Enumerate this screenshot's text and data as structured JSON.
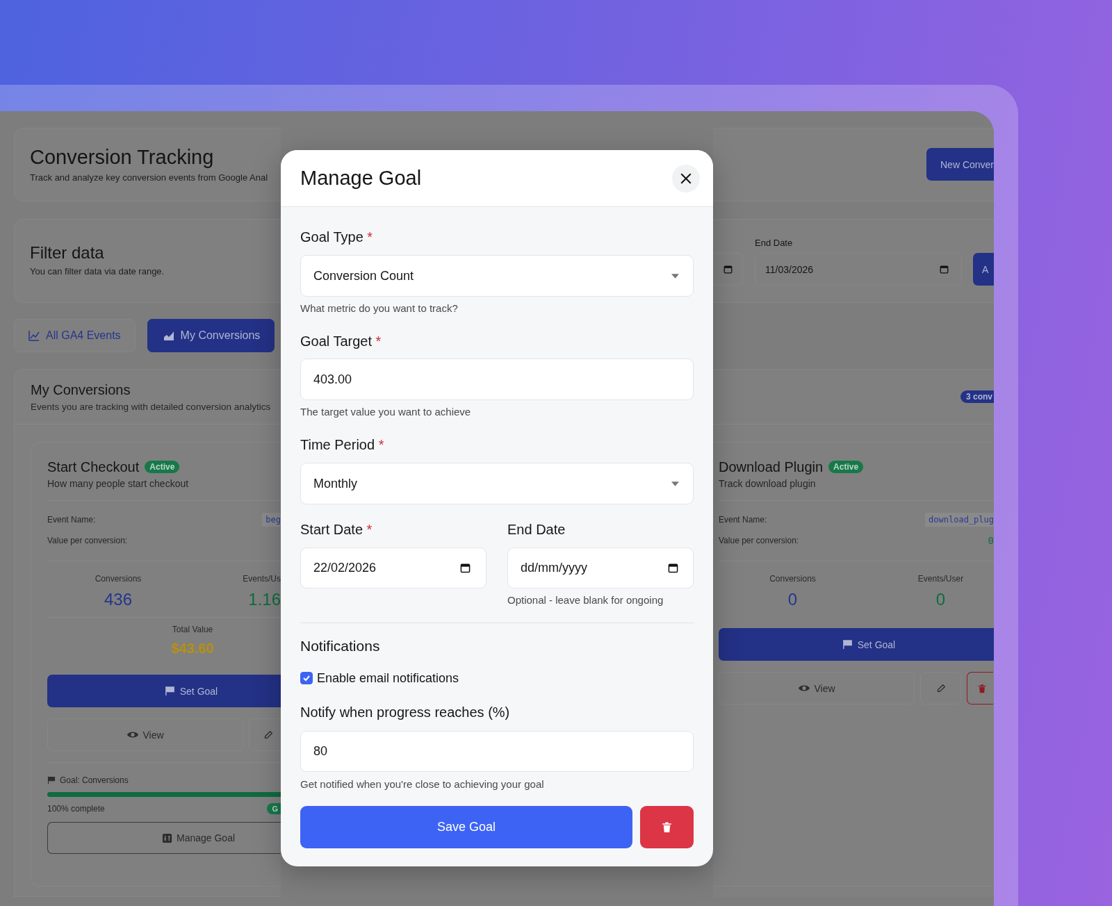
{
  "header": {
    "title": "Conversion Tracking",
    "subtitle": "Track and analyze key conversion events from Google Anal",
    "new_button": "New Conver"
  },
  "filter": {
    "title": "Filter data",
    "subtitle": "You can filter data via date range.",
    "end_date_label": "End Date",
    "end_date_value": "11/03/2026",
    "apply_button": "A"
  },
  "tabs": [
    {
      "label": "All GA4 Events",
      "selected": false
    },
    {
      "label": "My Conversions",
      "selected": true
    }
  ],
  "conversions": {
    "title": "My Conversions",
    "subtitle": "Events you are tracking with detailed conversion analytics",
    "count_badge": "3 conv",
    "cards": [
      {
        "title": "Start Checkout",
        "status": "Active",
        "description": "How many people start checkout",
        "event_name_label": "Event Name:",
        "event_name": "beg",
        "value_label": "Value per conversion:",
        "stats": [
          {
            "label": "Conversions",
            "value": "436"
          },
          {
            "label": "Events/Us",
            "value": "1.16"
          }
        ],
        "total_label": "Total Value",
        "total_value": "$43.60",
        "set_goal": "Set Goal",
        "view": "View",
        "goal": {
          "label": "Goal: Conversions",
          "level": 1,
          "progress_text": "100% complete",
          "badge": "G"
        },
        "manage_goal": "Manage Goal"
      },
      {
        "title": "Download Plugin",
        "status": "Active",
        "description": "Track download plugin",
        "event_name_label": "Event Name:",
        "event_name": "download_plug",
        "value_label": "Value per conversion:",
        "value": "0",
        "stats": [
          {
            "label": "Conversions",
            "value": "0"
          },
          {
            "label": "Events/User",
            "value": "0"
          }
        ],
        "set_goal": "Set Goal",
        "view": "View"
      }
    ]
  },
  "modal": {
    "title": "Manage Goal",
    "goal_type": {
      "label": "Goal Type",
      "required_mark": "*",
      "value": "Conversion Count",
      "hint": "What metric do you want to track?"
    },
    "goal_target": {
      "label": "Goal Target",
      "required_mark": "*",
      "value": "403.00",
      "hint": "The target value you want to achieve"
    },
    "time_period": {
      "label": "Time Period",
      "required_mark": "*",
      "value": "Monthly"
    },
    "start_date": {
      "label": "Start Date",
      "required_mark": "*",
      "value": "22/02/2026"
    },
    "end_date": {
      "label": "End Date",
      "placeholder": "dd/mm/yyyy",
      "hint": "Optional - leave blank for ongoing"
    },
    "notifications": {
      "title": "Notifications",
      "email": {
        "label": "Enable email notifications",
        "checked": true
      },
      "threshold": {
        "label": "Notify when progress reaches (%)",
        "value": "80",
        "hint": "Get notified when you're close to achieving your goal"
      }
    },
    "save_button": "Save Goal"
  }
}
